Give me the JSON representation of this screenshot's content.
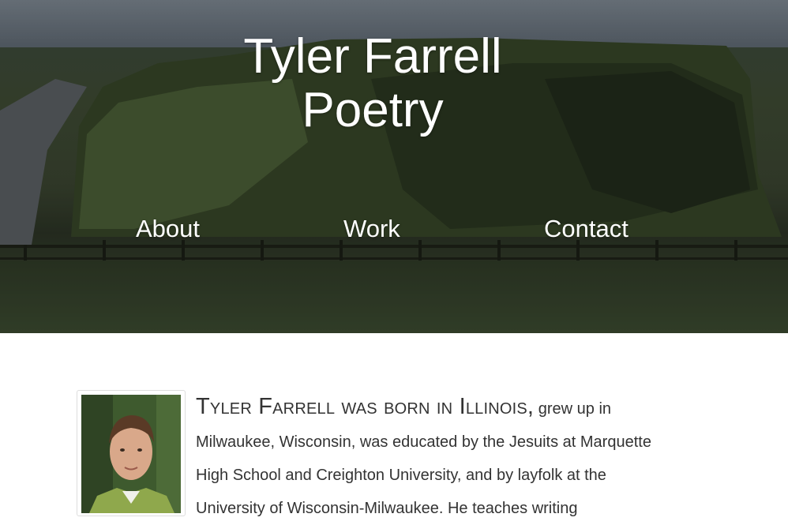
{
  "site": {
    "title_line1": "Tyler Farrell",
    "title_line2": "Poetry"
  },
  "nav": {
    "about": "About",
    "work": "Work",
    "contact": "Contact"
  },
  "bio": {
    "lead": "Tyler Farrell was born in Illinois,",
    "text": " grew up in Milwaukee, Wisconsin, was educated by the Jesuits at Marquette High School and Creighton University, and by layfolk at the University of Wisconsin-Milwaukee. He teaches writing"
  },
  "images": {
    "hero": "cliffside-landscape-photo",
    "author": "author-portrait-photo"
  }
}
